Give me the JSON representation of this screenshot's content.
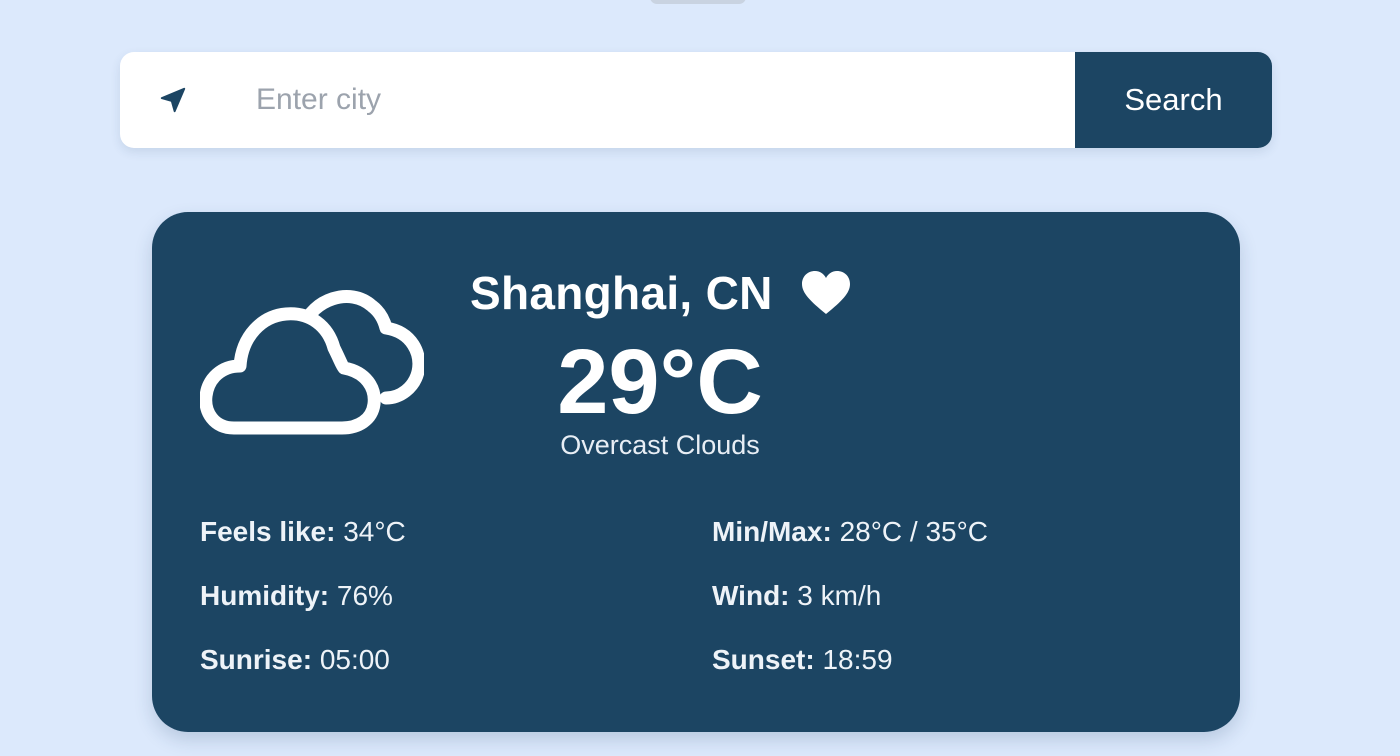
{
  "search": {
    "placeholder": "Enter city",
    "value": "",
    "button_label": "Search",
    "location_icon": "location-arrow-icon"
  },
  "weather": {
    "city": "Shanghai, CN",
    "temperature": "29°C",
    "description": "Overcast Clouds",
    "condition_icon": "cloud-icon",
    "favorite_icon": "heart-icon",
    "details": {
      "feels_like_label": "Feels like:",
      "feels_like_value": "34°C",
      "humidity_label": "Humidity:",
      "humidity_value": "76%",
      "sunrise_label": "Sunrise:",
      "sunrise_value": "05:00",
      "minmax_label": "Min/Max:",
      "minmax_value": "28°C / 35°C",
      "wind_label": "Wind:",
      "wind_value": "3 km/h",
      "sunset_label": "Sunset:",
      "sunset_value": "18:59"
    }
  },
  "colors": {
    "background": "#dce9fc",
    "card": "#1c4563",
    "button": "#1c4563",
    "text_light": "#ffffff"
  }
}
